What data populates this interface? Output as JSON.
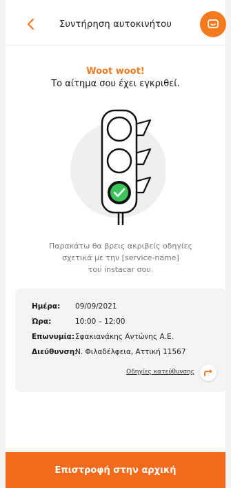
{
  "header": {
    "title": "Συντήρηση αυτοκινήτου",
    "back_icon": "chevron-left-icon",
    "chat_icon": "chat-icon"
  },
  "status": {
    "headline": "Woot woot!",
    "message": "Το αίτημα σου έχει εγκριθεί."
  },
  "description": {
    "line1": "Παρακάτω θα βρεις ακριβείς οδηγίες",
    "line2": "σχετικά με την [service-name]",
    "line3": "του instacar σου."
  },
  "details": {
    "date_label": "Ημέρα:",
    "date_value": "09/09/2021",
    "time_label": "Ώρα:",
    "time_value": "10:00 – 12:00",
    "name_label": "Επωνυμία:",
    "name_value": "Σφακιανάκης Αντώνης Α.Ε.",
    "address_label": "Διεύθυνση:",
    "address_value": "Ν. Φιλαδέλφεια, Αττική 11567",
    "directions_link": "Οδηγίες κατεύθυνσης",
    "directions_icon": "arrow-right-icon"
  },
  "cta": {
    "label": "Επιστροφή στην αρχική"
  },
  "colors": {
    "accent": "#f57a1e",
    "success": "#3cc45a",
    "card_bg": "#f4f4f4"
  }
}
